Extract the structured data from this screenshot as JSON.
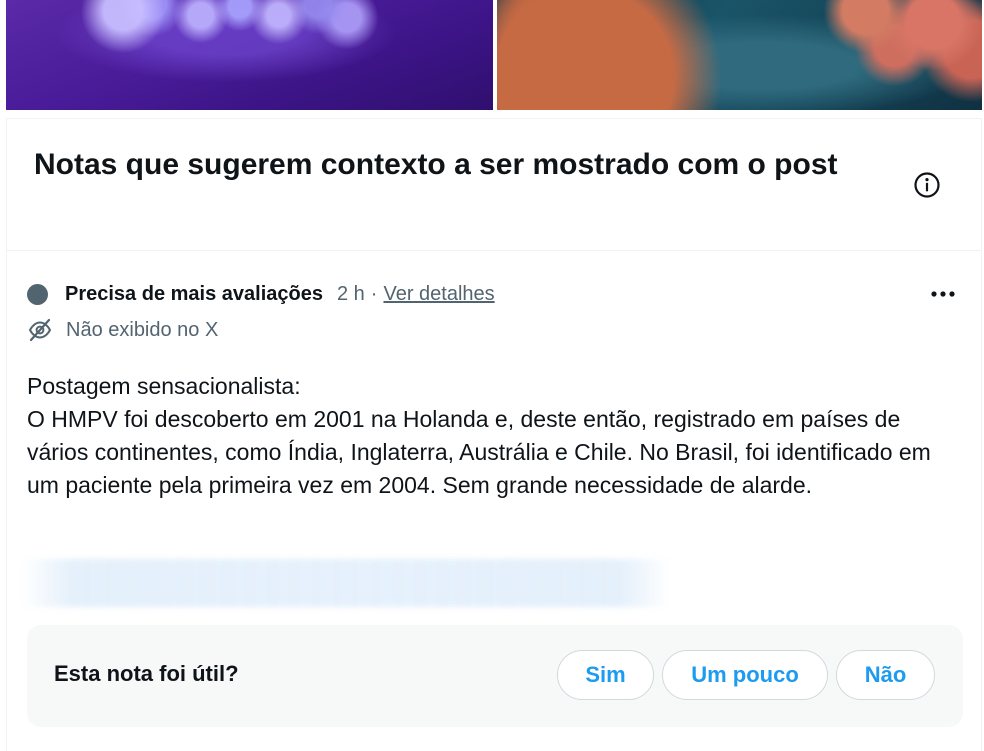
{
  "media": {
    "left_image": "virus-particles-purple-image",
    "right_image": "coronavirus-illustration-image"
  },
  "header": {
    "title": "Notas que sugerem contexto a ser mostrado com o post",
    "info_icon": "info-icon"
  },
  "note": {
    "status": "Precisa de mais avaliações",
    "status_color": "#536471",
    "time": "2 h",
    "separator": "·",
    "details_link": "Ver detalhes",
    "more_icon": "more-horizontal-icon",
    "not_shown_icon": "eye-off-icon",
    "not_shown": "Não exibido no X",
    "body": "Postagem sensacionalista:\nO HMPV foi descoberto em 2001 na Holanda e, deste então, registrado em países de vários continentes, como Índia, Inglaterra, Austrália e Chile. No Brasil, foi identificado em um paciente pela primeira vez em 2004. Sem grande necessidade de alarde."
  },
  "rating": {
    "question": "Esta nota foi útil?",
    "yes": "Sim",
    "somewhat": "Um pouco",
    "no": "Não",
    "accent_color": "#1d9bf0"
  }
}
